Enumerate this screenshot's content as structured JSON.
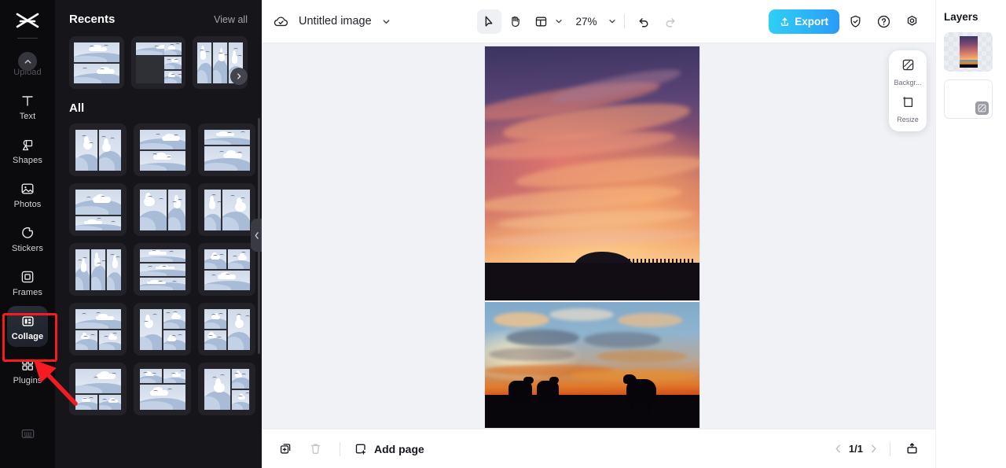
{
  "rail": {
    "logo_icon": "capcut-logo-icon",
    "collapse_icon": "chevron-up-icon",
    "items": [
      {
        "label": "Upload",
        "icon": "upload-icon",
        "state": "dimmed"
      },
      {
        "label": "Text",
        "icon": "text-icon",
        "state": "normal"
      },
      {
        "label": "Shapes",
        "icon": "shapes-icon",
        "state": "normal"
      },
      {
        "label": "Photos",
        "icon": "photos-icon",
        "state": "normal"
      },
      {
        "label": "Stickers",
        "icon": "stickers-icon",
        "state": "normal"
      },
      {
        "label": "Frames",
        "icon": "frames-icon",
        "state": "normal"
      },
      {
        "label": "Collage",
        "icon": "collage-icon",
        "state": "active"
      },
      {
        "label": "Plugins",
        "icon": "plugins-icon",
        "state": "normal"
      }
    ],
    "bottom_icon": "keyboard-shortcuts-icon"
  },
  "annotation": {
    "highlight_color": "#f51b21",
    "target": "Collage",
    "arrow_icon": "pointer-arrow-icon"
  },
  "panel": {
    "recents_title": "Recents",
    "view_all_label": "View all",
    "all_title": "All",
    "next_icon": "chevron-right-icon",
    "collapse_icon": "chevron-left-icon",
    "recent_templates": [
      {
        "name": "2-row horizontal split"
      },
      {
        "name": "left large with 3 right stack"
      },
      {
        "name": "3 vertical columns"
      }
    ],
    "all_templates": [
      {
        "name": "2 vertical columns"
      },
      {
        "name": "2 equal rows"
      },
      {
        "name": "top small row, large bottom"
      },
      {
        "name": "large top, thin bottom row"
      },
      {
        "name": "wide left, narrow right"
      },
      {
        "name": "narrow left, wide right"
      },
      {
        "name": "3 vertical columns"
      },
      {
        "name": "3 horizontal rows"
      },
      {
        "name": "2 top cells, wide bottom"
      },
      {
        "name": "wide top, 2 bottom cells"
      },
      {
        "name": "left column, 2 right cells"
      },
      {
        "name": "2 left cells, right column"
      },
      {
        "name": "large top, 2 small bottom"
      },
      {
        "name": "2 small top, large bottom"
      },
      {
        "name": "left large, 2 right stacked"
      }
    ]
  },
  "topbar": {
    "save_status_icon": "cloud-check-icon",
    "doc_title": "Untitled image",
    "title_dropdown_icon": "chevron-down-icon",
    "tools": [
      {
        "name": "select-tool",
        "icon": "cursor-arrow-icon",
        "selected": true
      },
      {
        "name": "hand-tool",
        "icon": "hand-icon",
        "selected": false
      },
      {
        "name": "layout-tool",
        "icon": "layout-grid-icon",
        "selected": false
      }
    ],
    "layout_dropdown_icon": "chevron-down-icon",
    "zoom_level": "27%",
    "zoom_dropdown_icon": "chevron-down-icon",
    "undo": {
      "label": "Undo",
      "icon": "undo-icon",
      "enabled": true
    },
    "redo": {
      "label": "Redo",
      "icon": "redo-icon",
      "enabled": false
    },
    "export_label": "Export",
    "export_icon": "upload-share-icon",
    "export_color": "#2a9bf7",
    "right_icons": [
      {
        "name": "shield-check-icon"
      },
      {
        "name": "help-question-icon"
      },
      {
        "name": "settings-gear-icon"
      }
    ]
  },
  "float_panel": {
    "items": [
      {
        "label": "Backgr...",
        "icon": "background-hatch-icon"
      },
      {
        "label": "Resize",
        "icon": "resize-crop-icon"
      }
    ]
  },
  "canvas": {
    "images": [
      {
        "name": "sunset-clouds-hill-photo",
        "alt": "Purple and orange sunset clouds over a dark horizon with a hill"
      },
      {
        "name": "cattle-silhouette-sunset-photo",
        "alt": "Silhouetted cattle against a blue and orange sunset sky"
      }
    ]
  },
  "bottombar": {
    "duplicate": {
      "label": "Duplicate page",
      "icon": "duplicate-page-icon",
      "enabled": true
    },
    "delete": {
      "label": "Delete page",
      "icon": "trash-icon",
      "enabled": false
    },
    "add_page_label": "Add page",
    "add_page_icon": "add-page-icon",
    "prev_icon": "chevron-left-icon",
    "next_icon": "chevron-right-icon",
    "page_indicator": "1/1",
    "present_icon": "present-export-icon"
  },
  "layers": {
    "title": "Layers",
    "items": [
      {
        "name": "image-layer",
        "selected": true,
        "badge": null
      },
      {
        "name": "background-layer",
        "selected": false,
        "badge": "transparent-badge-icon"
      }
    ]
  }
}
